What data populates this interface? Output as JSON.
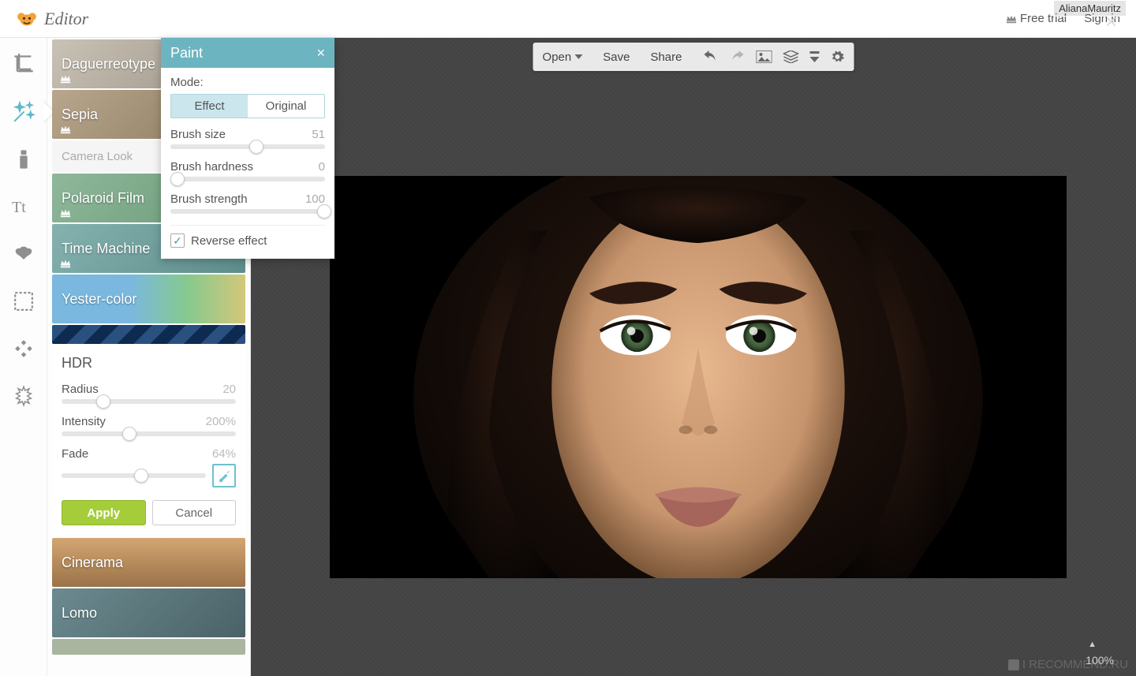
{
  "header": {
    "title": "Editor",
    "free_trial": "Free trial",
    "sign_in": "Sign in"
  },
  "rail": {
    "tools": [
      "crop",
      "magic",
      "touchup",
      "text",
      "overlay",
      "frame",
      "texture",
      "snowflake"
    ]
  },
  "effects": [
    {
      "name": "Daguerreotype",
      "crown": true
    },
    {
      "name": "Sepia",
      "crown": true
    },
    {
      "name": "Camera Look"
    },
    {
      "name": "Polaroid Film",
      "crown": true
    },
    {
      "name": "Time Machine",
      "crown": true
    },
    {
      "name": "Yester-color"
    },
    {
      "name": "HDR"
    },
    {
      "name": "Cinerama"
    },
    {
      "name": "Lomo"
    }
  ],
  "hdr": {
    "title": "HDR",
    "radius_label": "Radius",
    "radius_value": "20",
    "radius_pct": 20,
    "intensity_label": "Intensity",
    "intensity_value": "200%",
    "intensity_pct": 35,
    "fade_label": "Fade",
    "fade_value": "64%",
    "fade_pct": 50,
    "apply": "Apply",
    "cancel": "Cancel"
  },
  "paint": {
    "title": "Paint",
    "mode_label": "Mode:",
    "mode_effect": "Effect",
    "mode_original": "Original",
    "brush_size_label": "Brush size",
    "brush_size_value": "51",
    "brush_size_pct": 51,
    "brush_hardness_label": "Brush hardness",
    "brush_hardness_value": "0",
    "brush_hardness_pct": 0,
    "brush_strength_label": "Brush strength",
    "brush_strength_value": "100",
    "brush_strength_pct": 97,
    "reverse_label": "Reverse effect"
  },
  "toolbar": {
    "open": "Open",
    "save": "Save",
    "share": "Share"
  },
  "canvas": {
    "zoom": "100%"
  },
  "watermark": {
    "user": "AlianaMauritz",
    "site": "I RECOMMEND.RU"
  }
}
